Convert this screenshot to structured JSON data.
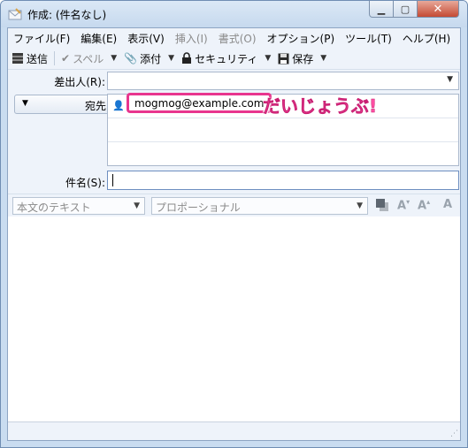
{
  "window": {
    "title": "作成: (件名なし)",
    "minimize_glyph": "▁",
    "maximize_glyph": "▢",
    "close_glyph": "✕"
  },
  "menu": [
    {
      "label": "ファイル(F)",
      "enabled": true
    },
    {
      "label": "編集(E)",
      "enabled": true
    },
    {
      "label": "表示(V)",
      "enabled": true
    },
    {
      "label": "挿入(I)",
      "enabled": false
    },
    {
      "label": "書式(O)",
      "enabled": false
    },
    {
      "label": "オプション(P)",
      "enabled": true
    },
    {
      "label": "ツール(T)",
      "enabled": true
    },
    {
      "label": "ヘルプ(H)",
      "enabled": true
    }
  ],
  "toolbar": {
    "send_label": "送信",
    "spell_label": "スペル",
    "attach_label": "添付",
    "security_label": "セキュリティ",
    "save_label": "保存"
  },
  "headers": {
    "from_label": "差出人(R):",
    "from_value": "",
    "to_type": "宛先:",
    "recipient": "mogmog@example.com",
    "subject_label": "件名(S):",
    "subject_value": ""
  },
  "annotation": "だいじょうぶ!",
  "format": {
    "paragraph_style": "本文のテキスト",
    "font": "プロポーショナル"
  },
  "colors": {
    "highlight": "#e8358e",
    "annotation": "#ff4fa3"
  }
}
